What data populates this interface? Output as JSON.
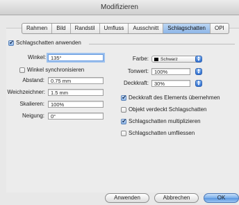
{
  "window": {
    "title": "Modifizieren"
  },
  "tabs": [
    "Rahmen",
    "Bild",
    "Randstil",
    "Umfluss",
    "Ausschnitt",
    "Schlagschatten",
    "OPI"
  ],
  "active_tab": "Schlagschatten",
  "shadow_group": {
    "label": "Schlagschatten anwenden",
    "checked": true
  },
  "left": {
    "winkel_label": "Winkel:",
    "winkel_value": "135°",
    "sync_label": "Winkel synchronisieren",
    "sync_checked": false,
    "abstand_label": "Abstand:",
    "abstand_value": "0.75 mm",
    "weich_label": "Weichzeichner:",
    "weich_value": "1.5 mm",
    "skalieren_label": "Skalieren:",
    "skalieren_value": "100%",
    "neigung_label": "Neigung:",
    "neigung_value": "0°"
  },
  "right": {
    "farbe_label": "Farbe:",
    "farbe_value": "Schwarz",
    "farbe_color": "#000000",
    "tonwert_label": "Tonwert:",
    "tonwert_value": "100%",
    "deckkraft_label": "Deckkraft:",
    "deckkraft_value": "30%",
    "options": [
      {
        "label": "Deckkraft des Elements übernehmen",
        "checked": true
      },
      {
        "label": "Objekt verdeckt Schlagschatten",
        "checked": false
      },
      {
        "label": "Schlagschatten multiplizieren",
        "checked": true
      },
      {
        "label": "Schlagschatten umfliessen",
        "checked": false
      }
    ]
  },
  "buttons": {
    "apply": "Anwenden",
    "cancel": "Abbrechen",
    "ok": "OK"
  }
}
